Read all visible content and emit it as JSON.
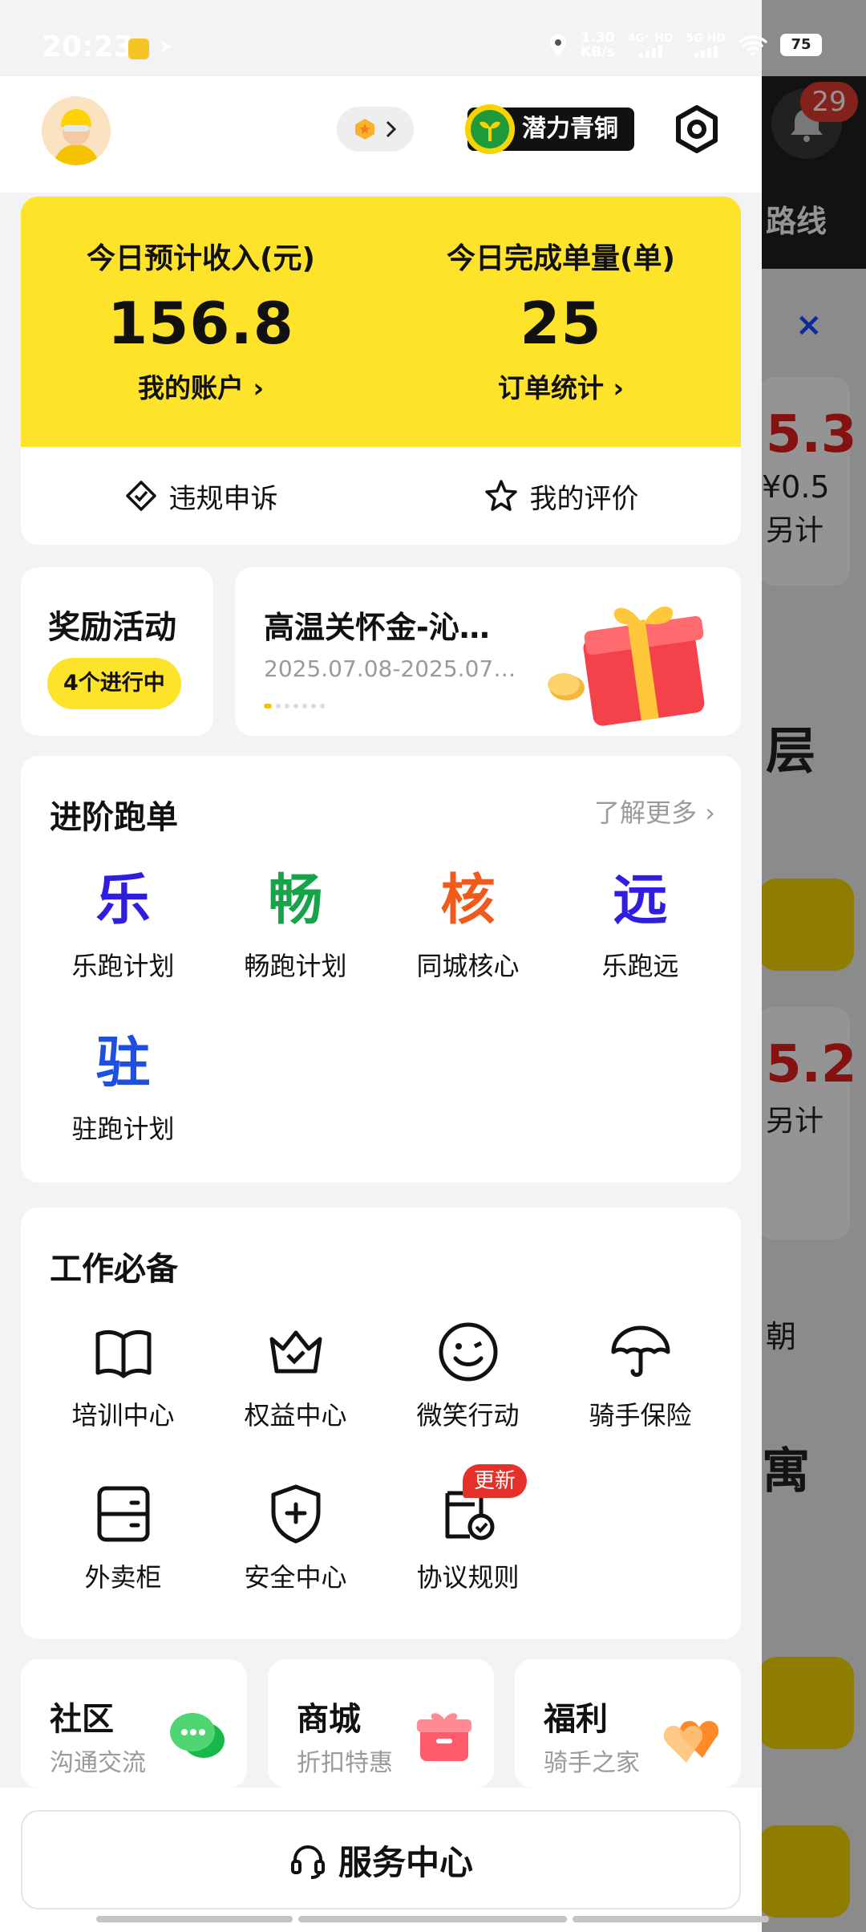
{
  "status_bar": {
    "time": "20:23",
    "speed_value": "1.30",
    "speed_unit": "KB/s",
    "net1": "4G⁺ HD",
    "net2": "5G HD",
    "battery": "75"
  },
  "background": {
    "route_label": "路线",
    "notification_count": "29",
    "amount1": "5.3",
    "amount2": "¥0.5",
    "extra1": "另计",
    "amount3": "5.2",
    "extra2": "另计",
    "char1": "层",
    "char2": "朝",
    "char3": "寓",
    "close": "×"
  },
  "header": {
    "level_label": "潜力青铜"
  },
  "income": {
    "left": {
      "label": "今日预计收入(元)",
      "value": "156.8",
      "link": "我的账户"
    },
    "right": {
      "label": "今日完成单量(单)",
      "value": "25",
      "link": "订单统计"
    },
    "actions": [
      {
        "label": "违规申诉",
        "icon": "diamond-check-icon"
      },
      {
        "label": "我的评价",
        "icon": "star-icon"
      }
    ]
  },
  "reward": {
    "title": "奖励活动",
    "badge": "4个进行中",
    "banner_title": "高温关怀金-沁…",
    "banner_date": "2025.07.08-2025.07…"
  },
  "advanced": {
    "title": "进阶跑单",
    "more": "了解更多",
    "items": [
      {
        "glyph": "乐",
        "label": "乐跑计划",
        "color": "#2f1de0"
      },
      {
        "glyph": "畅",
        "label": "畅跑计划",
        "color": "#16a34a"
      },
      {
        "glyph": "核",
        "label": "同城核心",
        "color": "#f05a1a"
      },
      {
        "glyph": "远",
        "label": "乐跑远",
        "color": "#2f1de0"
      },
      {
        "glyph": "驻",
        "label": "驻跑计划",
        "color": "#1d4fe0"
      }
    ]
  },
  "essentials": {
    "title": "工作必备",
    "new_badge": "更新",
    "items": [
      {
        "label": "培训中心",
        "icon": "book-icon"
      },
      {
        "label": "权益中心",
        "icon": "crown-icon"
      },
      {
        "label": "微笑行动",
        "icon": "smile-icon"
      },
      {
        "label": "骑手保险",
        "icon": "umbrella-icon"
      },
      {
        "label": "外卖柜",
        "icon": "locker-icon"
      },
      {
        "label": "安全中心",
        "icon": "shield-icon"
      },
      {
        "label": "协议规则",
        "icon": "document-check-icon"
      }
    ]
  },
  "bottom_cards": [
    {
      "title": "社区",
      "subtitle": "沟通交流",
      "icon": "chat-bubble-icon"
    },
    {
      "title": "商城",
      "subtitle": "折扣特惠",
      "icon": "gift-box-icon"
    },
    {
      "title": "福利",
      "subtitle": "骑手之家",
      "icon": "heart-icon"
    }
  ],
  "service": {
    "label": "服务中心"
  }
}
